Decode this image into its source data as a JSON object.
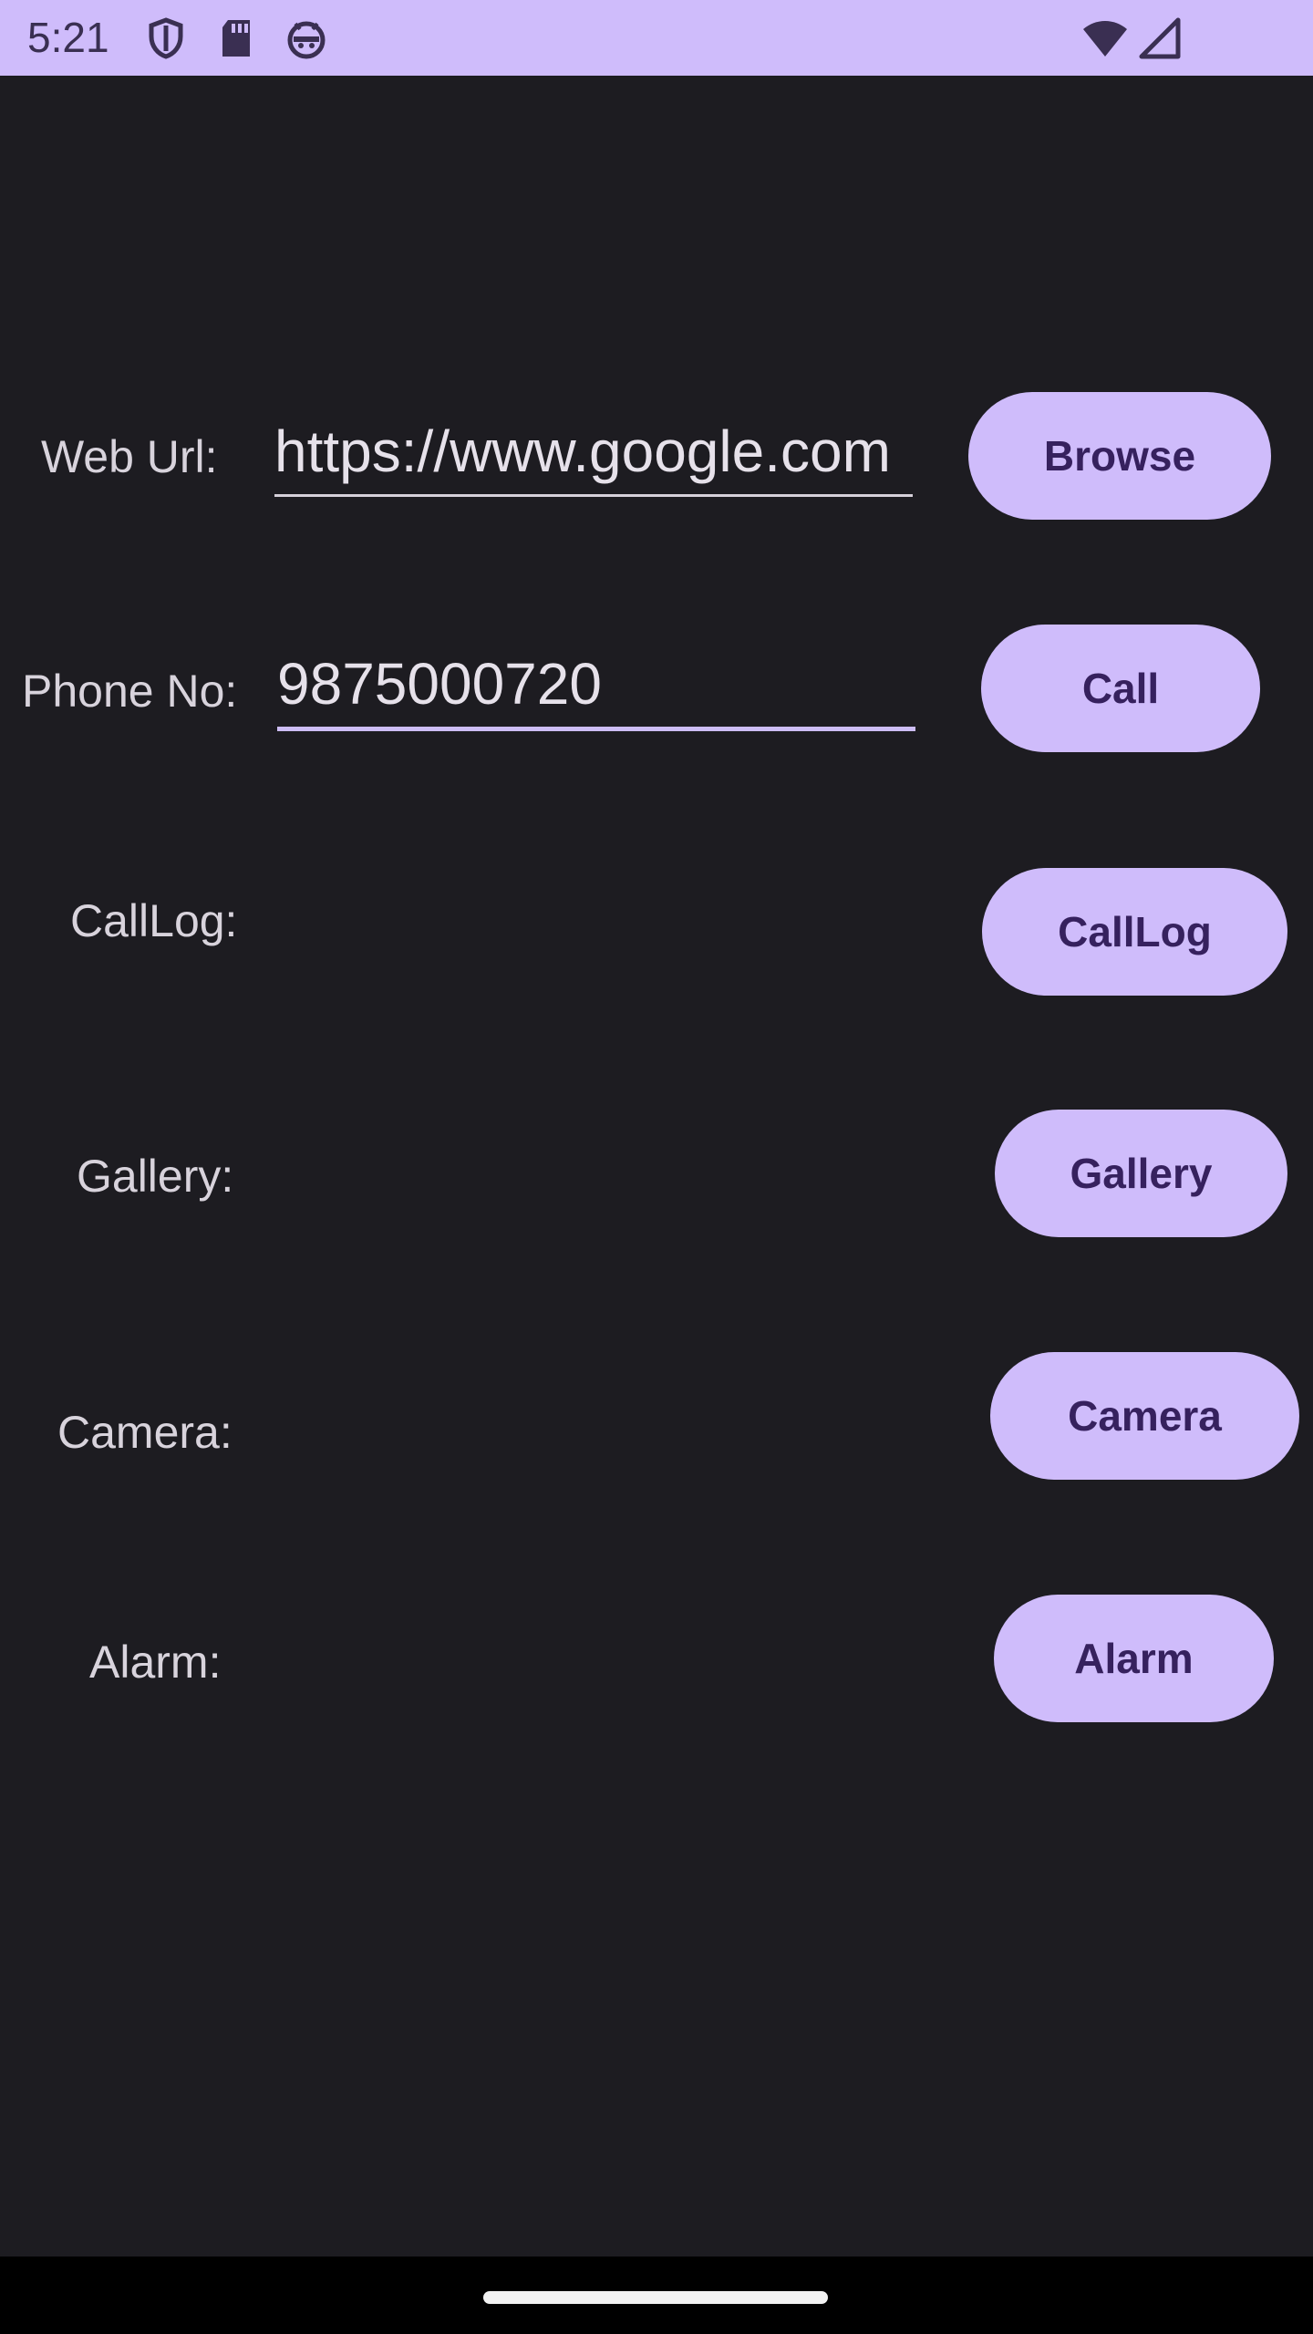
{
  "status_bar": {
    "time": "5:21",
    "icons": [
      "shield-icon",
      "sd-card-icon",
      "android-face-icon",
      "wifi-icon",
      "cellular-signal-icon"
    ],
    "background": "#cfbcfb"
  },
  "colors": {
    "background": "#1d1c21",
    "button_bg": "#cfbcfb",
    "button_text": "#36215e",
    "label_text": "#d8d3dc",
    "focus_underline": "#cdbdf6"
  },
  "rows": {
    "web_url": {
      "label": "Web Url:",
      "value": "https://www.google.com",
      "button": "Browse"
    },
    "phone": {
      "label": "Phone No:",
      "value": "9875000720",
      "button": "Call"
    },
    "calllog": {
      "label": "CallLog:",
      "button": "CallLog"
    },
    "gallery": {
      "label": "Gallery:",
      "button": "Gallery"
    },
    "camera": {
      "label": "Camera:",
      "button": "Camera"
    },
    "alarm": {
      "label": "Alarm:",
      "button": "Alarm"
    }
  }
}
